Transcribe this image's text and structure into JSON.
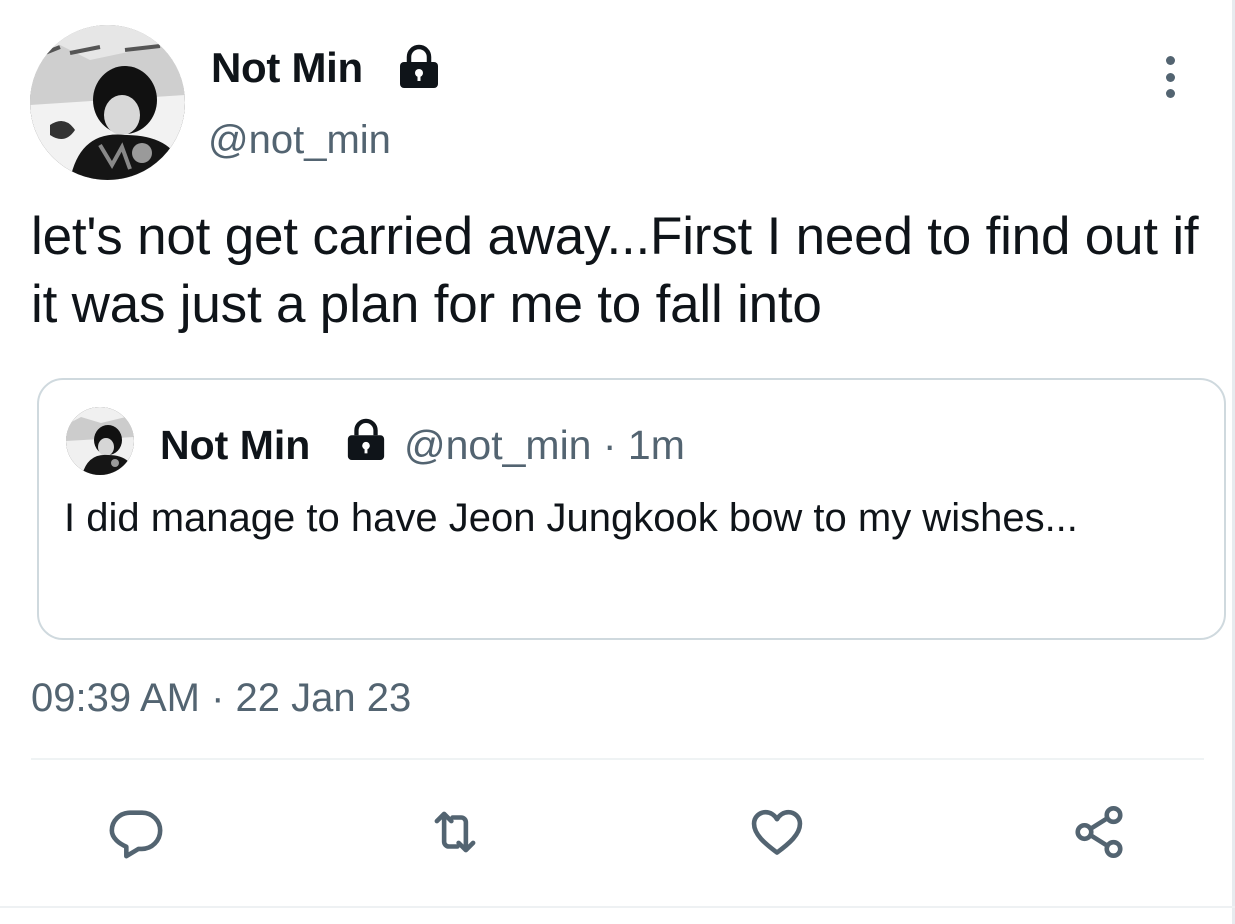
{
  "tweet": {
    "display_name": "Not Min",
    "handle": "@not_min",
    "protected": true,
    "text": "let's not get carried away...First I need to find out if it was just a plan for me to fall into",
    "timestamp": "09:39 AM · 22 Jan 23"
  },
  "quoted_tweet": {
    "display_name": "Not Min",
    "meta": "@not_min · 1m",
    "protected": true,
    "text": "I did manage to have Jeon Jungkook bow to my wishes..."
  },
  "actions": {
    "reply_icon": "reply-icon",
    "retweet_icon": "retweet-icon",
    "like_icon": "heart-icon",
    "share_icon": "share-icon"
  },
  "colors": {
    "text_primary": "#0f1419",
    "text_secondary": "#536471",
    "border": "#cfd9de"
  }
}
